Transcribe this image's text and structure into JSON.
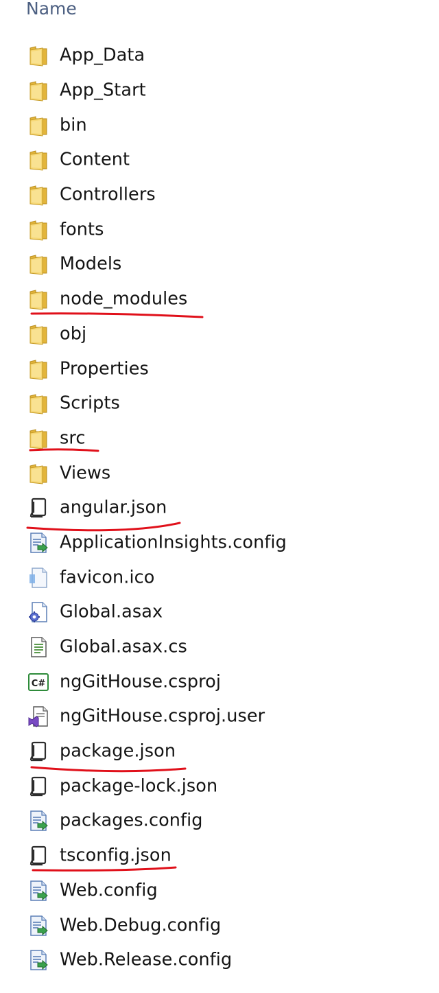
{
  "header": {
    "name_column": "Name"
  },
  "items": [
    {
      "label": "App_Data",
      "type": "folder",
      "icon": "folder-icon"
    },
    {
      "label": "App_Start",
      "type": "folder",
      "icon": "folder-icon"
    },
    {
      "label": "bin",
      "type": "folder",
      "icon": "folder-icon"
    },
    {
      "label": "Content",
      "type": "folder",
      "icon": "folder-icon"
    },
    {
      "label": "Controllers",
      "type": "folder",
      "icon": "folder-icon"
    },
    {
      "label": "fonts",
      "type": "folder",
      "icon": "folder-icon"
    },
    {
      "label": "Models",
      "type": "folder",
      "icon": "folder-icon"
    },
    {
      "label": "node_modules",
      "type": "folder",
      "icon": "folder-icon",
      "annotated": true
    },
    {
      "label": "obj",
      "type": "folder",
      "icon": "folder-icon"
    },
    {
      "label": "Properties",
      "type": "folder",
      "icon": "folder-icon"
    },
    {
      "label": "Scripts",
      "type": "folder",
      "icon": "folder-icon"
    },
    {
      "label": "src",
      "type": "folder",
      "icon": "folder-icon",
      "annotated": true
    },
    {
      "label": "Views",
      "type": "folder",
      "icon": "folder-icon"
    },
    {
      "label": "angular.json",
      "type": "json",
      "icon": "json-file-icon",
      "annotated": true
    },
    {
      "label": "ApplicationInsights.config",
      "type": "config",
      "icon": "config-file-icon"
    },
    {
      "label": "favicon.ico",
      "type": "ico",
      "icon": "image-file-icon"
    },
    {
      "label": "Global.asax",
      "type": "asax",
      "icon": "asax-file-icon"
    },
    {
      "label": "Global.asax.cs",
      "type": "cs",
      "icon": "text-file-icon"
    },
    {
      "label": "ngGitHouse.csproj",
      "type": "csproj",
      "icon": "csharp-project-icon"
    },
    {
      "label": "ngGitHouse.csproj.user",
      "type": "user",
      "icon": "visual-studio-file-icon"
    },
    {
      "label": "package.json",
      "type": "json",
      "icon": "json-file-icon",
      "annotated": true
    },
    {
      "label": "package-lock.json",
      "type": "json",
      "icon": "json-file-icon"
    },
    {
      "label": "packages.config",
      "type": "config",
      "icon": "config-file-icon"
    },
    {
      "label": "tsconfig.json",
      "type": "json",
      "icon": "json-file-icon",
      "annotated": true
    },
    {
      "label": "Web.config",
      "type": "config",
      "icon": "config-file-icon"
    },
    {
      "label": "Web.Debug.config",
      "type": "config",
      "icon": "config-file-icon"
    },
    {
      "label": "Web.Release.config",
      "type": "config",
      "icon": "config-file-icon"
    }
  ],
  "colors": {
    "folder": "#e8c24a",
    "annotation": "#e0101a",
    "header_text": "#4d6082"
  }
}
